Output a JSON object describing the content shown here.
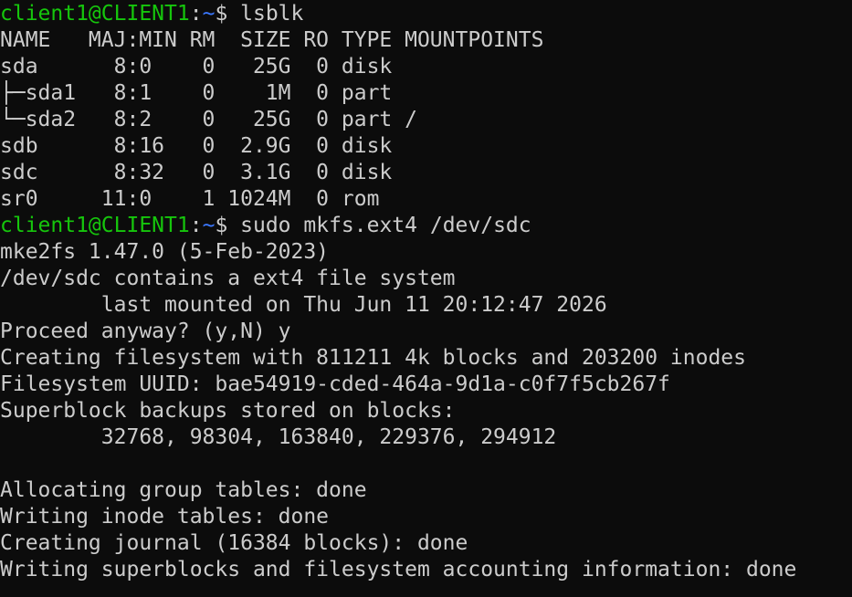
{
  "colors": {
    "background": "#0c0c0c",
    "foreground": "#cccccc",
    "prompt_user": "#16c60c",
    "prompt_path": "#3b78ff"
  },
  "prompt": {
    "user_host": "client1@CLIENT1",
    "colon": ":",
    "path": "~",
    "dollar": "$"
  },
  "command1": " lsblk",
  "lsblk_output": [
    "NAME   MAJ:MIN RM  SIZE RO TYPE MOUNTPOINTS",
    "sda      8:0    0   25G  0 disk",
    "├─sda1   8:1    0    1M  0 part",
    "└─sda2   8:2    0   25G  0 part /",
    "sdb      8:16   0  2.9G  0 disk",
    "sdc      8:32   0  3.1G  0 disk",
    "sr0     11:0    1 1024M  0 rom"
  ],
  "command2": " sudo mkfs.ext4 /dev/sdc",
  "mkfs_output": [
    "mke2fs 1.47.0 (5-Feb-2023)",
    "/dev/sdc contains a ext4 file system",
    "        last mounted on Thu Jun 11 20:12:47 2026",
    "Proceed anyway? (y,N) y",
    "Creating filesystem with 811211 4k blocks and 203200 inodes",
    "Filesystem UUID: bae54919-cded-464a-9d1a-c0f7f5cb267f",
    "Superblock backups stored on blocks:",
    "        32768, 98304, 163840, 229376, 294912",
    "",
    "Allocating group tables: done",
    "Writing inode tables: done",
    "Creating journal (16384 blocks): done",
    "Writing superblocks and filesystem accounting information: done"
  ]
}
